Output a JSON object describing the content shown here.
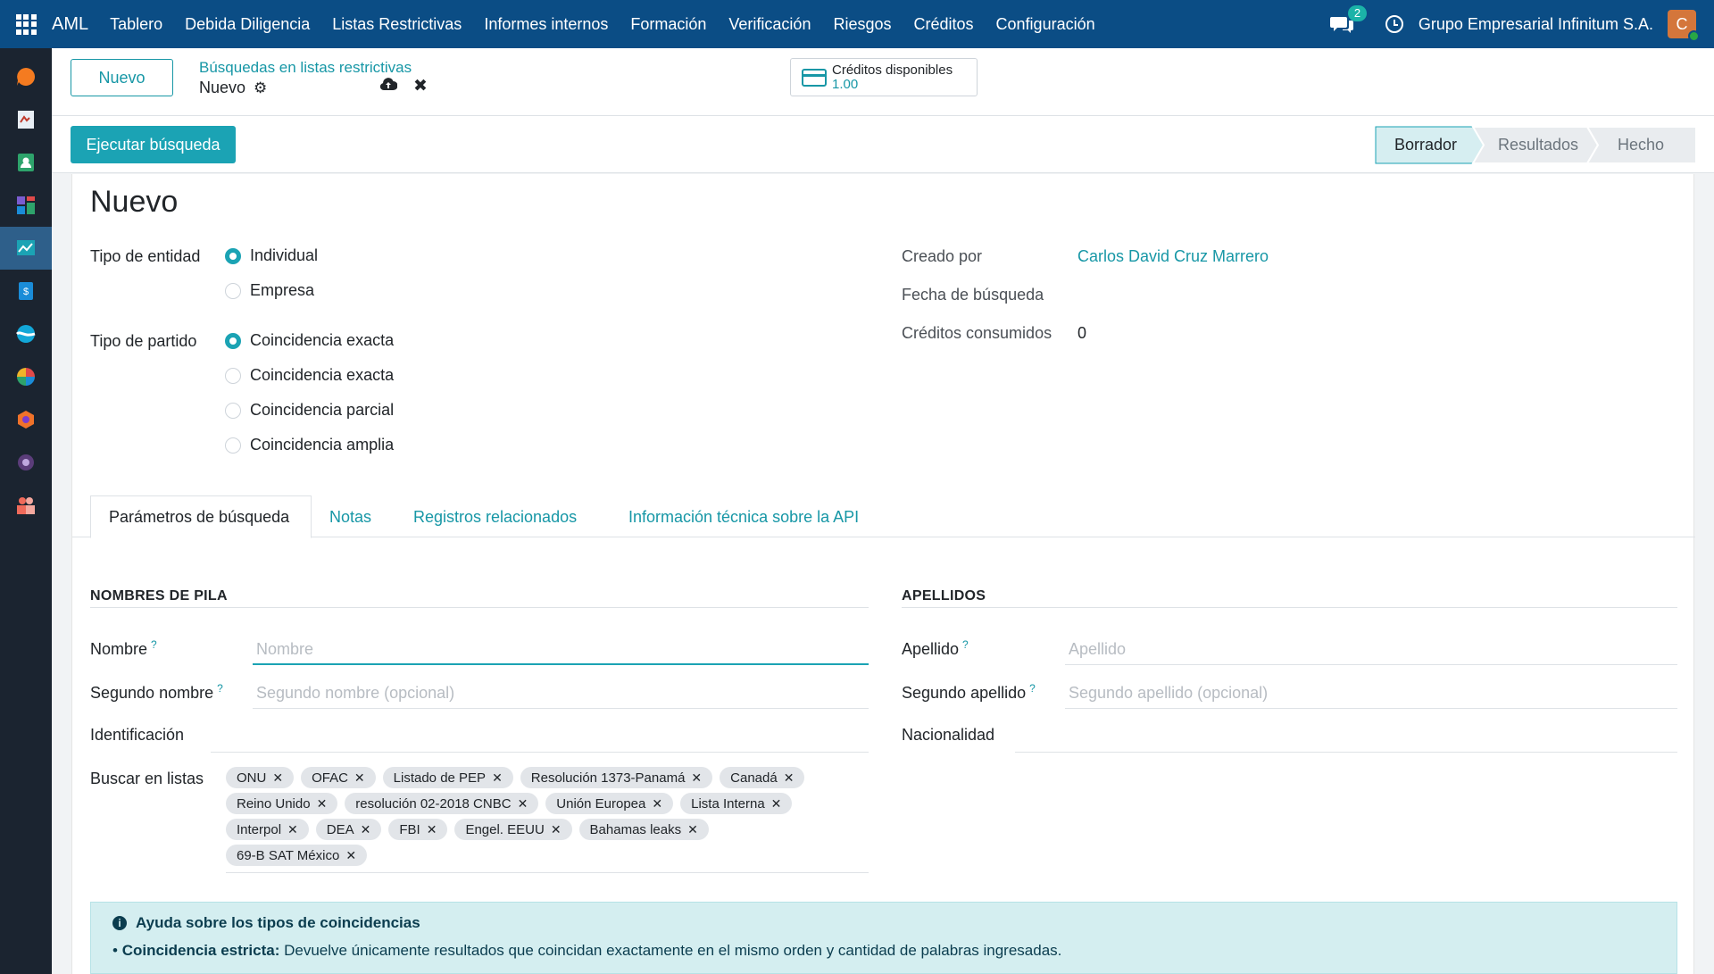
{
  "navbar": {
    "brand": "AML",
    "menu": [
      "Tablero",
      "Debida Diligencia",
      "Listas Restrictivas",
      "Informes internos",
      "Formación",
      "Verificación",
      "Riesgos",
      "Créditos",
      "Configuración"
    ],
    "chat_count": "2",
    "company": "Grupo Empresarial Infinitum S.A.",
    "avatar_initial": "C"
  },
  "sidebar": {
    "items": [
      {
        "icon": "chat-bubble-icon",
        "color": "#f47b20"
      },
      {
        "icon": "document-sign-icon",
        "color": "#e8eef5"
      },
      {
        "icon": "contacts-icon",
        "color": "#2ea36b"
      },
      {
        "icon": "dashboard-icon",
        "color": "#7a5ccf"
      },
      {
        "icon": "trend-chart-icon",
        "color": "#1ba3b4"
      },
      {
        "icon": "invoice-icon",
        "color": "#1a8cd8"
      },
      {
        "icon": "wave-icon",
        "color": "#12a7d8"
      },
      {
        "icon": "pie-chart-icon",
        "color": "#e04a4a"
      },
      {
        "icon": "hexagon-icon",
        "color": "#f0722a"
      },
      {
        "icon": "circle-target-icon",
        "color": "#9b59b6"
      },
      {
        "icon": "team-icon",
        "color": "#f06a5a"
      }
    ]
  },
  "control": {
    "new_button": "Nuevo",
    "breadcrumb": "Búsquedas en listas restrictivas",
    "current": "Nuevo",
    "credits_label": "Créditos disponibles",
    "credits_value": "1.00"
  },
  "status": {
    "execute_button": "Ejecutar búsqueda",
    "stages": [
      "Borrador",
      "Resultados",
      "Hecho"
    ],
    "active_stage": "Borrador"
  },
  "form": {
    "title": "Nuevo",
    "entity_type_label": "Tipo de entidad",
    "entity_options": [
      "Individual",
      "Empresa"
    ],
    "match_type_label": "Tipo de partido",
    "match_options": [
      "Coincidencia exacta",
      "Coincidencia exacta",
      "Coincidencia parcial",
      "Coincidencia amplia"
    ],
    "created_by_label": "Creado por",
    "created_by_value": "Carlos David Cruz Marrero",
    "search_date_label": "Fecha de búsqueda",
    "credits_used_label": "Créditos consumidos",
    "credits_used_value": "0"
  },
  "tabs": [
    "Parámetros de búsqueda",
    "Notas",
    "Registros relacionados",
    "Información técnica sobre la API"
  ],
  "params": {
    "first_names_title": "NOMBRES DE PILA",
    "last_names_title": "APELLIDOS",
    "name_label": "Nombre",
    "name_placeholder": "Nombre",
    "middle_name_label": "Segundo nombre",
    "middle_name_placeholder": "Segundo nombre (opcional)",
    "id_label": "Identificación",
    "lists_label": "Buscar en listas",
    "surname_label": "Apellido",
    "surname_placeholder": "Apellido",
    "second_surname_label": "Segundo apellido",
    "second_surname_placeholder": "Segundo apellido (opcional)",
    "nationality_label": "Nacionalidad",
    "help_mark": "?",
    "tag_remove": "✕",
    "tag_rows": [
      [
        "ONU",
        "OFAC",
        "Listado de PEP",
        "Resolución 1373-Panamá",
        "Canadá"
      ],
      [
        "Reino Unido",
        "resolución 02-2018 CNBC",
        "Unión Europea",
        "Lista Interna"
      ],
      [
        "Interpol",
        "DEA",
        "FBI",
        "Engel. EEUU",
        "Bahamas leaks"
      ],
      [
        "69-B SAT México"
      ]
    ]
  },
  "help": {
    "title": "Ayuda sobre los tipos de coincidencias",
    "item_term": "Coincidencia estricta:",
    "item_text": " Devuelve únicamente resultados que coincidan exactamente en el mismo orden y cantidad de palabras ingresadas."
  }
}
